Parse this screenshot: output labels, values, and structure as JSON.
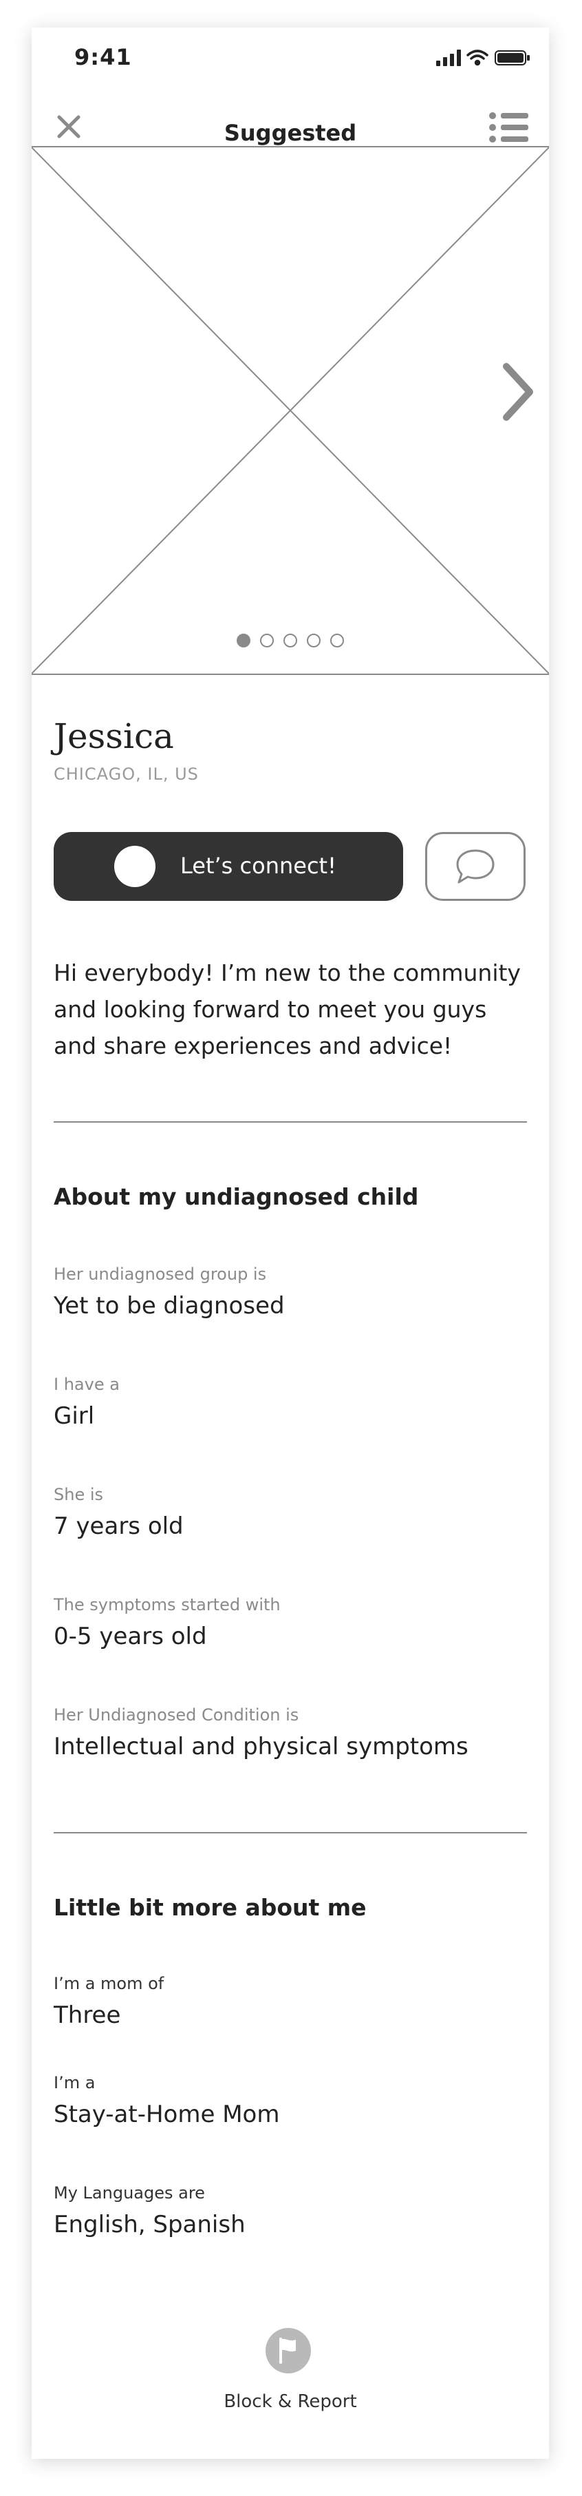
{
  "status_bar": {
    "time": "9:41"
  },
  "header": {
    "title": "Suggested"
  },
  "carousel": {
    "dots": 5,
    "active_index": 0
  },
  "profile": {
    "name": "Jessica",
    "location": "CHICAGO, IL, US",
    "connect_label": "Let’s connect!",
    "bio": "Hi everybody! I’m new to the community and looking forward to meet you guys and share experiences and advice!"
  },
  "about_child": {
    "title": "About my undiagnosed child",
    "fields": [
      {
        "label": "Her undiagnosed group is",
        "value": "Yet to be diagnosed"
      },
      {
        "label": "I have a",
        "value": "Girl"
      },
      {
        "label": "She is",
        "value": "7 years old"
      },
      {
        "label": "The symptoms started with",
        "value": "0-5 years old"
      },
      {
        "label": "Her Undiagnosed Condition is",
        "value": "Intellectual and physical symptoms"
      }
    ]
  },
  "about_me": {
    "title": "Little bit more about me",
    "fields": [
      {
        "label": "I’m a mom of",
        "value": "Three"
      },
      {
        "label": "I’m a",
        "value": "Stay-at-Home Mom"
      },
      {
        "label": "My Languages are",
        "value": "English, Spanish"
      }
    ]
  },
  "footer": {
    "report_label": "Block & Report"
  },
  "icons": {
    "close": "close-icon",
    "menu": "list-menu-icon",
    "next": "chevron-right-icon",
    "message": "chat-bubble-icon",
    "report": "flag-icon",
    "signal": "signal-icon",
    "wifi": "wifi-icon",
    "battery": "battery-icon"
  },
  "colors": {
    "primary_button": "#333333",
    "muted_text": "#8a8a8a",
    "line": "#8a8a8a"
  }
}
